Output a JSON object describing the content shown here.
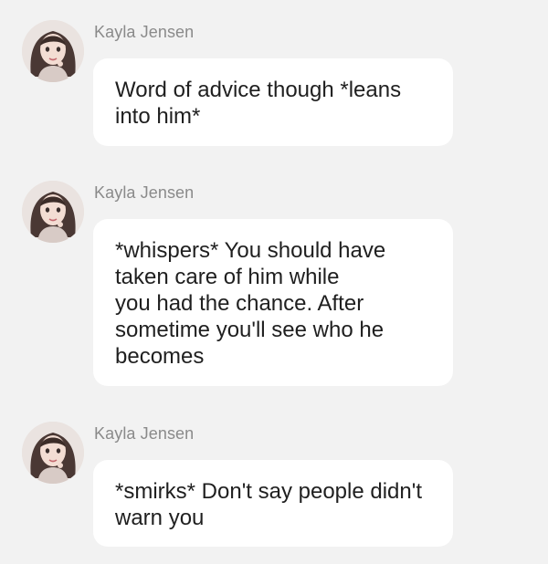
{
  "messages": [
    {
      "sender": "Kayla Jensen",
      "avatar_icon": "woman-avatar-icon",
      "lines": [
        "Word of advice though *leans",
        "into him*"
      ]
    },
    {
      "sender": "Kayla Jensen",
      "avatar_icon": "woman-avatar-icon",
      "lines": [
        "*whispers* You should have",
        "taken care of him while",
        "you had the chance. After",
        "sometime you'll see who he",
        "becomes"
      ]
    },
    {
      "sender": "Kayla Jensen",
      "avatar_icon": "woman-avatar-icon",
      "lines": [
        "*smirks* Don't say people didn't",
        "warn you"
      ]
    }
  ],
  "colors": {
    "background": "#f2f2f2",
    "bubble": "#ffffff",
    "text": "#1f1f1f",
    "sender": "#8a8a8a"
  }
}
